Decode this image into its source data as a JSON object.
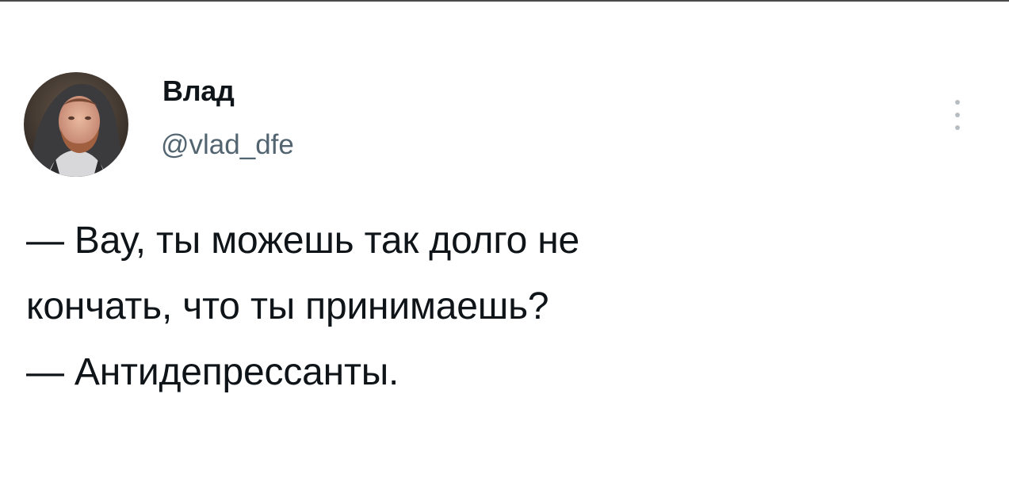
{
  "tweet": {
    "author": {
      "name": "Влад",
      "handle": "@vlad_dfe",
      "avatar_icon": "user-photo-avatar"
    },
    "more_icon": "more-vertical-icon",
    "text_lines": [
      "— Вау, ты можешь так долго не",
      "кончать, что ты принимаешь?",
      "— Антидепрессанты."
    ]
  },
  "colors": {
    "name": "#0f1419",
    "handle": "#536471",
    "text": "#0f1419",
    "more_dots": "#b6bec4",
    "background": "#ffffff"
  }
}
